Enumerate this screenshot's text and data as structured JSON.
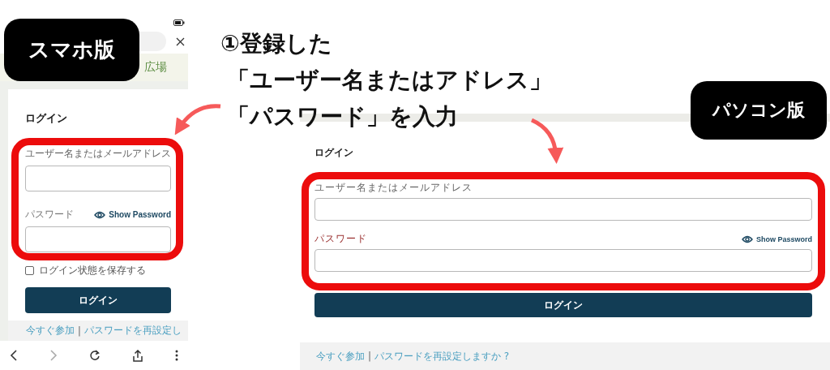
{
  "caption": {
    "lines": [
      "①登録した",
      "「ユーザー名またはアドレス」",
      "「パスワード」を入力"
    ]
  },
  "phone": {
    "tag": "スマホ版",
    "header_link": "広場",
    "login": {
      "title": "ログイン",
      "fields": [
        {
          "label": "ユーザー名またはメールアドレス",
          "kind": "text"
        },
        {
          "label": "パスワード",
          "kind": "password",
          "toggle": "Show Password"
        }
      ],
      "remember": {
        "label": "ログイン状態を保存する",
        "checked": false
      },
      "button": "ログイン",
      "links": [
        "今すぐ参加",
        "パスワードを再設定し"
      ],
      "separator": "|"
    }
  },
  "pc": {
    "tag": "パソコン版",
    "login": {
      "title": "ログイン",
      "fields": [
        {
          "label": "ユーザー名またはメールアドレス",
          "kind": "text"
        },
        {
          "label": "パスワード",
          "kind": "password",
          "toggle": "Show Password"
        }
      ],
      "button": "ログイン",
      "links": [
        "今すぐ参加",
        "パスワードを再設定しますか ?"
      ],
      "separator": "|"
    }
  }
}
